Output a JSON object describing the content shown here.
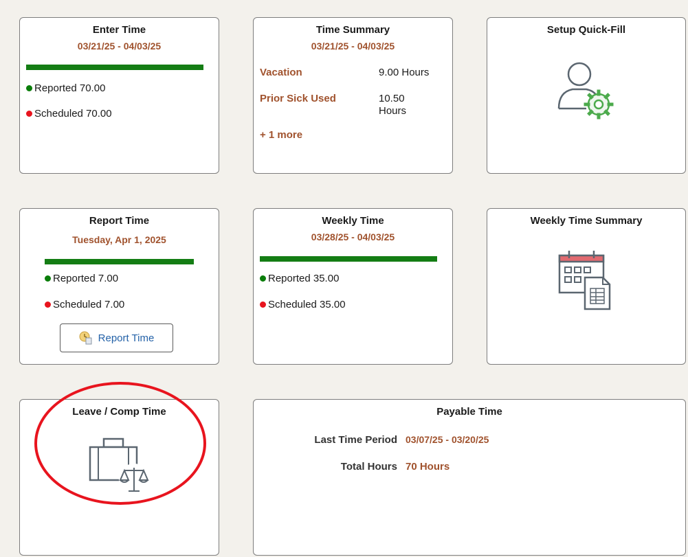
{
  "tiles": {
    "enter_time": {
      "title": "Enter Time",
      "period": "03/21/25 - 04/03/25",
      "reported": "Reported 70.00",
      "scheduled": "Scheduled 70.00"
    },
    "time_summary": {
      "title": "Time Summary",
      "period": "03/21/25 - 04/03/25",
      "rows": [
        {
          "label": "Vacation",
          "value": "9.00 Hours"
        },
        {
          "label": "Prior Sick Used",
          "value_line1": "10.50",
          "value_line2": "Hours"
        }
      ],
      "more": "+ 1 more"
    },
    "setup_quick_fill": {
      "title": "Setup Quick-Fill",
      "icon": "user-gear-icon"
    },
    "report_time": {
      "title": "Report Time",
      "date": "Tuesday, Apr 1, 2025",
      "reported": "Reported 7.00",
      "scheduled": "Scheduled 7.00",
      "button_label": "Report Time"
    },
    "weekly_time": {
      "title": "Weekly Time",
      "period": "03/28/25 - 04/03/25",
      "reported": "Reported 35.00",
      "scheduled": "Scheduled 35.00"
    },
    "weekly_time_summary": {
      "title": "Weekly Time Summary",
      "icon": "calendar-spreadsheet-icon"
    },
    "leave_comp_time": {
      "title": "Leave / Comp Time",
      "icon": "briefcase-scales-icon"
    },
    "payable_time": {
      "title": "Payable Time",
      "last_period_label": "Last Time Period",
      "last_period_value": "03/07/25 - 03/20/25",
      "total_hours_label": "Total Hours",
      "total_hours_value": "70 Hours"
    }
  },
  "colors": {
    "accent_text": "#a0522d",
    "progress_green": "#147d14",
    "status_green": "#0a7d0a",
    "status_red": "#e8141e",
    "highlight_circle": "#e8141e"
  }
}
